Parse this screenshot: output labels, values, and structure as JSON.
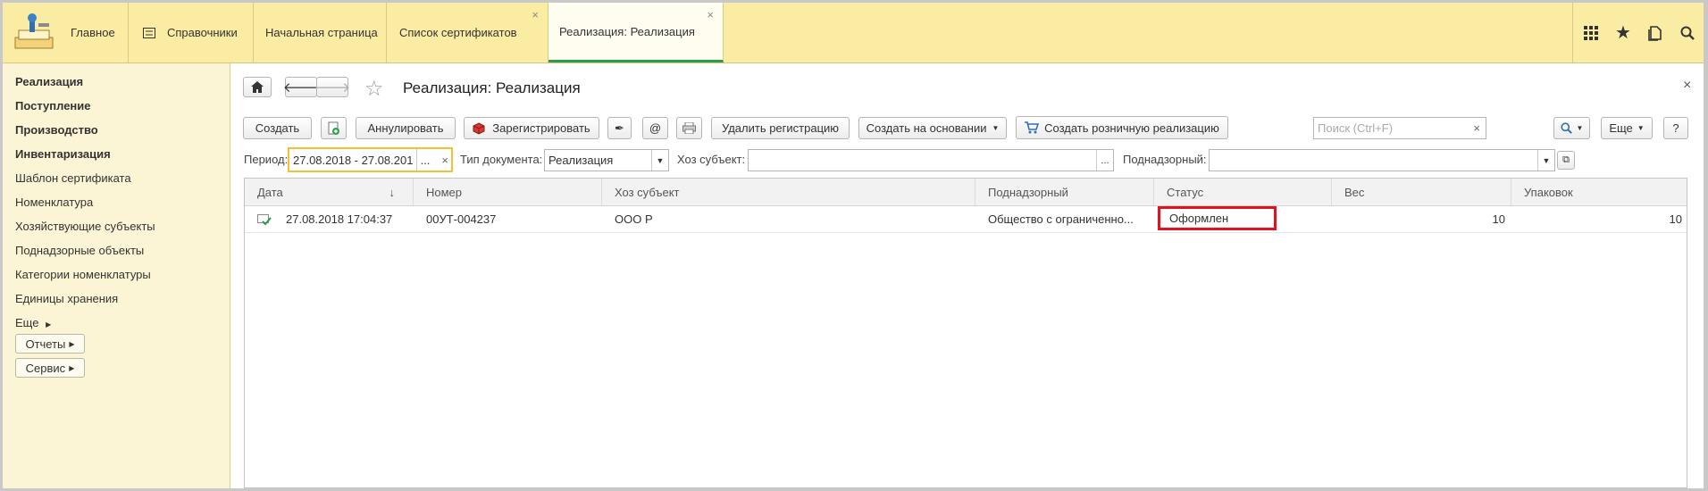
{
  "topbar": {
    "home_label": "Главное",
    "directories_label": "Справочники",
    "tabs": [
      {
        "label": "Начальная страница"
      },
      {
        "label": "Список сертификатов"
      },
      {
        "label": "Реализация: Реализация"
      }
    ]
  },
  "sidebar": {
    "items": [
      {
        "label": "Реализация"
      },
      {
        "label": "Поступление"
      },
      {
        "label": "Производство"
      },
      {
        "label": "Инвентаризация"
      },
      {
        "label": "Шаблон сертификата"
      },
      {
        "label": "Номенклатура"
      },
      {
        "label": "Хозяйствующие субъекты"
      },
      {
        "label": "Поднадзорные объекты"
      },
      {
        "label": "Категории номенклатуры"
      },
      {
        "label": "Единицы хранения"
      },
      {
        "label": "Еще"
      }
    ],
    "reports_label": "Отчеты",
    "service_label": "Сервис"
  },
  "main": {
    "title": "Реализация: Реализация",
    "toolbar": {
      "create": "Создать",
      "annul": "Аннулировать",
      "register": "Зарегистрировать",
      "at": "@",
      "delete_registration": "Удалить регистрацию",
      "create_based_on": "Создать на основании",
      "create_retail": "Создать розничную реализацию",
      "search_placeholder": "Поиск (Ctrl+F)",
      "more": "Еще",
      "help": "?"
    },
    "filters": {
      "period_label": "Период:",
      "period_value": "27.08.2018 - 27.08.201",
      "doctype_label": "Тип документа:",
      "doctype_value": "Реализация",
      "subject_label": "Хоз субъект:",
      "subject_value": "",
      "supervised_label": "Поднадзорный:",
      "supervised_value": "",
      "ellipsis": "..."
    },
    "table": {
      "columns": [
        "Дата",
        "Номер",
        "Хоз субъект",
        "Поднадзорный",
        "Статус",
        "Вес",
        "Упаковок"
      ],
      "rows": [
        {
          "date": "27.08.2018 17:04:37",
          "number": "00УТ-004237",
          "subject": "ООО  Р",
          "supervised": "Общество с ограниченно...",
          "status": "Оформлен",
          "weight": "10",
          "packages": "10"
        }
      ]
    }
  },
  "colors": {
    "topbar_bg": "#fbeca3",
    "sidebar_bg": "#fbf5d6",
    "active_tab_underline": "#2e9a4a",
    "status_highlight": "#e0141e"
  }
}
